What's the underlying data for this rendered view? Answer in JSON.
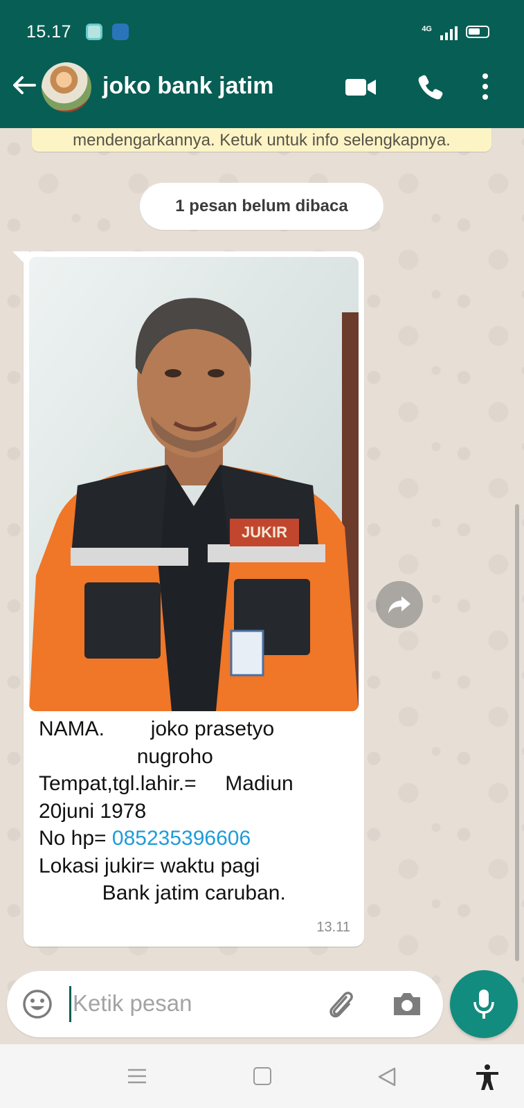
{
  "status_bar": {
    "time": "15.17",
    "network": "4G",
    "icons": [
      "app-notification-icon",
      "browser-notification-icon",
      "signal-icon",
      "battery-icon"
    ]
  },
  "header": {
    "back_icon": "arrow-left-icon",
    "contact_name": "joko bank jatim",
    "actions": [
      "video-call-icon",
      "phone-icon",
      "more-vertical-icon"
    ]
  },
  "chat": {
    "encryption_notice": "mendengarkannya. Ketuk untuk info selengkapnya.",
    "unread_divider": "1 pesan belum dibaca",
    "message": {
      "caption_lines": [
        {
          "text": "NAMA.        joko prasetyo"
        },
        {
          "text": "                 nugroho"
        },
        {
          "text": "Tempat,tgl.lahir.=     Madiun"
        },
        {
          "text": "20juni 1978"
        },
        {
          "prefix": "No hp= ",
          "link": "085235396606"
        },
        {
          "text": "Lokasi jukir= waktu pagi"
        },
        {
          "text": "           Bank jatim caruban."
        }
      ],
      "time": "13.11",
      "photo_badge_text": "JUKIR"
    }
  },
  "composer": {
    "placeholder": "Ketik pesan",
    "icons": [
      "emoji-icon",
      "paperclip-icon",
      "camera-icon",
      "microphone-icon"
    ]
  },
  "nav_bar": {
    "icons": [
      "menu-icon",
      "home-icon",
      "back-triangle-icon",
      "accessibility-icon"
    ]
  },
  "colors": {
    "header": "#075e54",
    "accent": "#128c7e",
    "link": "#1e9bd8",
    "chat_background": "#e7dfd6",
    "notice_background": "#fdf4c5"
  }
}
